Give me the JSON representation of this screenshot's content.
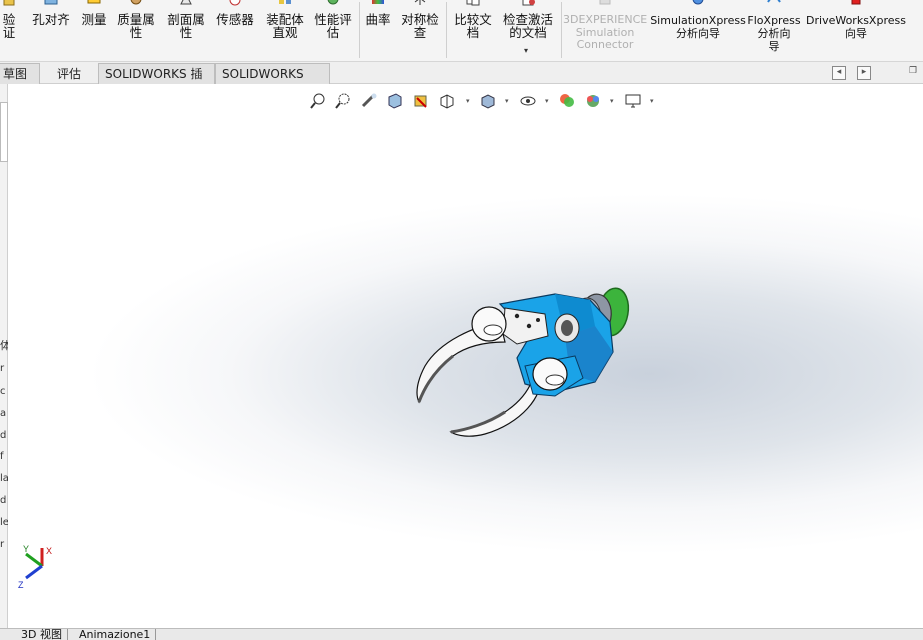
{
  "ribbon": {
    "buttons": [
      {
        "id": "design-check",
        "label": "设计检验证",
        "shown": "验\n证"
      },
      {
        "id": "hole-alignment",
        "label": "孔对齐"
      },
      {
        "id": "measure",
        "label": "测量"
      },
      {
        "id": "mass-properties",
        "label": "质量属\n性"
      },
      {
        "id": "section-properties",
        "label": "剖面属\n性"
      },
      {
        "id": "sensor",
        "label": "传感器"
      },
      {
        "id": "assembly-visualization",
        "label": "装配体\n直观"
      },
      {
        "id": "performance-evaluation",
        "label": "性能评\n估"
      },
      {
        "id": "curvature",
        "label": "曲率"
      },
      {
        "id": "symmetry-check",
        "label": "对称检\n查"
      },
      {
        "id": "compare-documents",
        "label": "比较文\n档"
      },
      {
        "id": "check-active-document",
        "label": "检查激活\n的文档"
      },
      {
        "id": "3dexperience-simulation",
        "label": "3DEXPERIENCE\nSimulation\nConnector"
      },
      {
        "id": "simulationxpress",
        "label": "SimulationXpress\n分析向导"
      },
      {
        "id": "floxpress",
        "label": "FloXpress\n分析向\n导"
      },
      {
        "id": "driveworksxpress",
        "label": "DriveWorksXpress\n向导"
      }
    ]
  },
  "tabs": {
    "sketch": "草图",
    "evaluate": "评估",
    "addins": "SOLIDWORKS 插件",
    "mbd": "SOLIDWORKS MBD"
  },
  "left_strip": {
    "tab_label": "体",
    "chars": [
      "r",
      "c",
      "a",
      "d",
      "f",
      "la",
      "d",
      "le",
      "r"
    ]
  },
  "bottom_tabs": {
    "view3d": "3D 视图",
    "animation": "Animazione1"
  },
  "triad": {
    "x": "X",
    "y": "Y",
    "z": "Z"
  },
  "colors": {
    "accent": "#2aa7e8",
    "model_blue": "#19a0e6",
    "model_green": "#3cb43c",
    "background_mid": "#d9dee5"
  }
}
